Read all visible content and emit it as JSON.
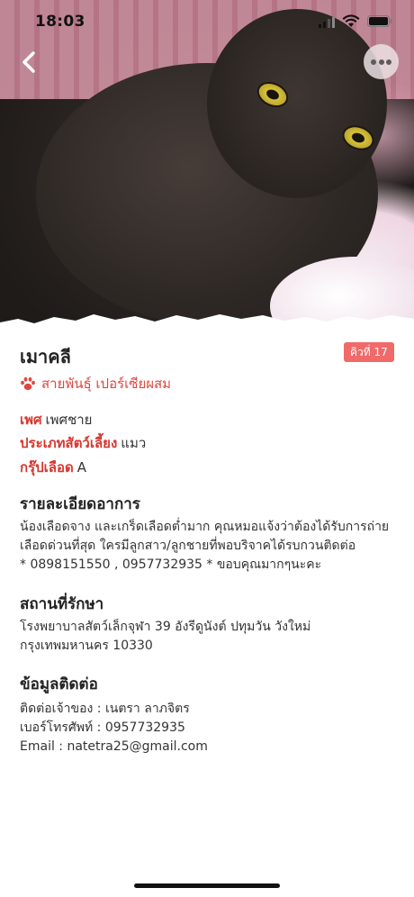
{
  "status": {
    "time": "18:03"
  },
  "pet": {
    "name": "เมาคลี",
    "queue_label": "คิวที่ 17",
    "breed": "สายพันธุ์ เปอร์เซียผสม",
    "attributes": [
      {
        "key": "เพศ",
        "value": "เพศชาย"
      },
      {
        "key": "ประเภทสัตว์เลี้ยง",
        "value": "แมว"
      },
      {
        "key": "กรุ๊ปเลือด",
        "value": "A"
      }
    ]
  },
  "symptoms": {
    "heading": "รายละเอียดอาการ",
    "lines": [
      "น้องเลือดจาง และเกร็ดเลือดต่ำมาก คุณหมอแจ้งว่าต้องได้รับการถ่าย",
      "เลือดด่วนที่สุด ใครมีลูกสาว/ลูกชายที่พอบริจาคได้รบกวนติดต่อ",
      "* 0898151550 , 0957732935 * ขอบคุณมากๆนะคะ"
    ]
  },
  "location": {
    "heading": "สถานที่รักษา",
    "lines": [
      "โรงพยาบาลสัตว์เล็กจุฬา 39 อังรีดูนังต์ ปทุมวัน วังใหม่",
      "กรุงเทพมหานคร 10330"
    ]
  },
  "contact": {
    "heading": "ข้อมูลติดต่อ",
    "lines": [
      "ติดต่อเจ้าของ : เนตรา ลาภจิตร",
      "เบอร์โทรศัพท์ : 0957732935",
      "Email : natetra25@gmail.com"
    ]
  },
  "colors": {
    "accent": "#d8362e",
    "badge": "#f06a6a"
  },
  "icons": {
    "back": "chevron-left-icon",
    "more": "more-horizontal-icon",
    "breed": "paw-icon"
  }
}
